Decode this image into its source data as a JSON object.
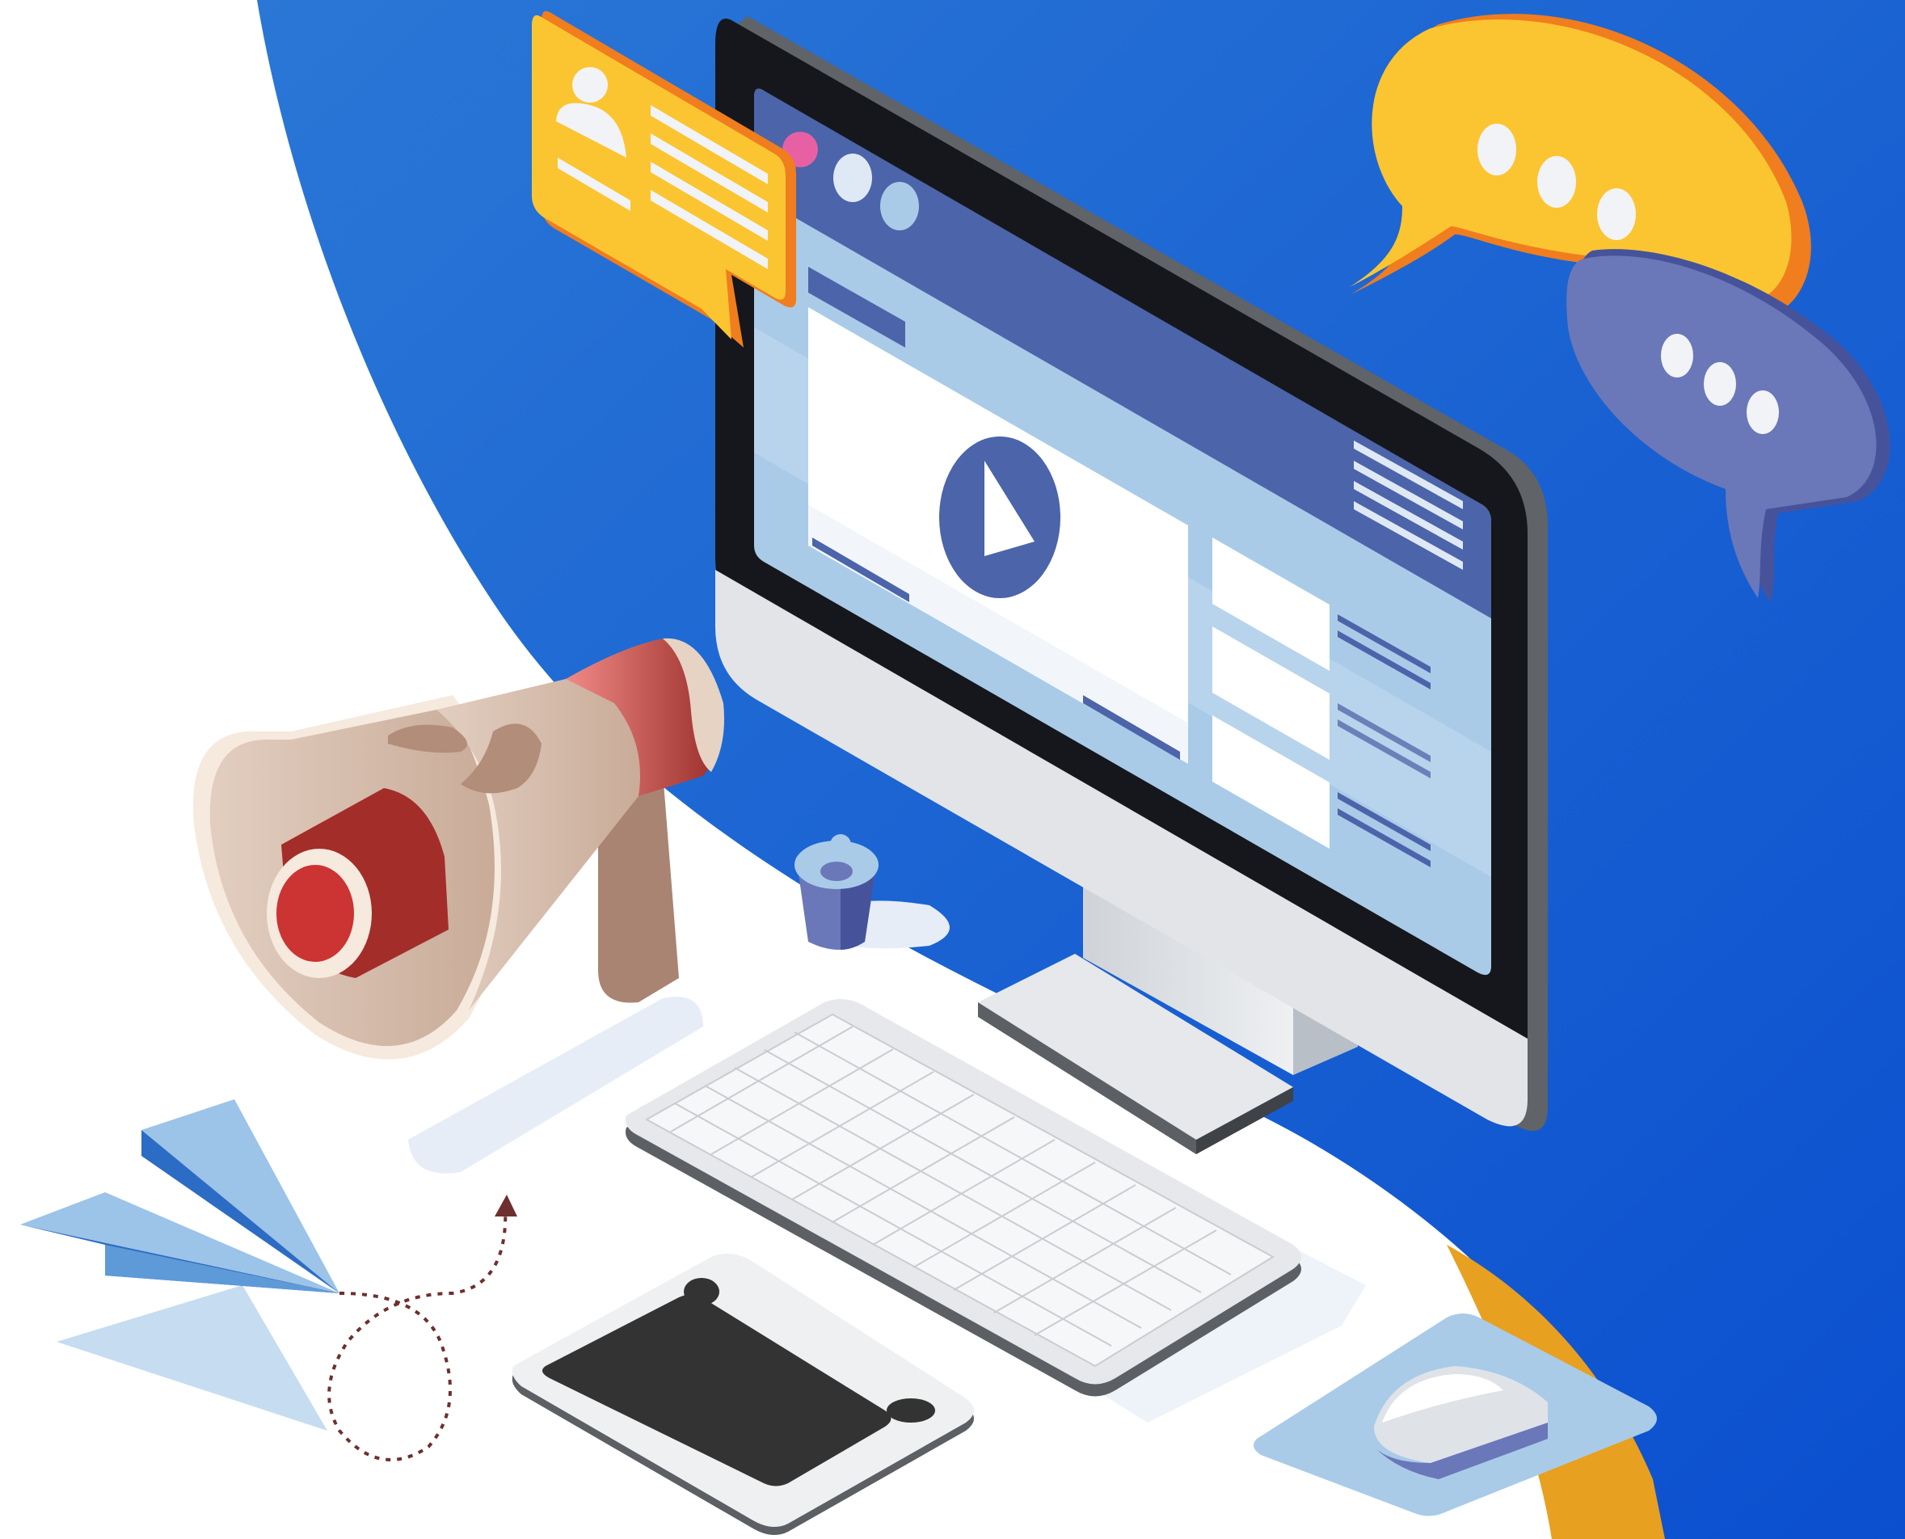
{
  "illustration": {
    "style": "isometric digital-marketing illustration",
    "palette": {
      "background": "#ffffff",
      "blue_blob": "#1a5fd0",
      "orange_accent": "#e8a020",
      "yellow_card": "#fbc531",
      "orange_edge": "#f07d1e",
      "purple_bubble": "#6a77b8",
      "screen_blue": "#a9cbe8",
      "screen_dark": "#4b64aa",
      "megaphone_body": "#dcc8b8",
      "megaphone_red": "#cc3333",
      "paper_plane": "#9cc3e8"
    },
    "icons": [
      "blue-background-blob-icon",
      "profile-card-icon",
      "yellow-chat-bubble-icon",
      "purple-chat-bubble-icon",
      "monitor-icon",
      "browser-window-icon",
      "play-button-icon",
      "megaphone-icon",
      "cup-icon",
      "keyboard-icon",
      "graphics-tablet-icon",
      "mouse-icon",
      "mousepad-icon",
      "paper-plane-icon",
      "dotted-flight-path-icon"
    ]
  }
}
